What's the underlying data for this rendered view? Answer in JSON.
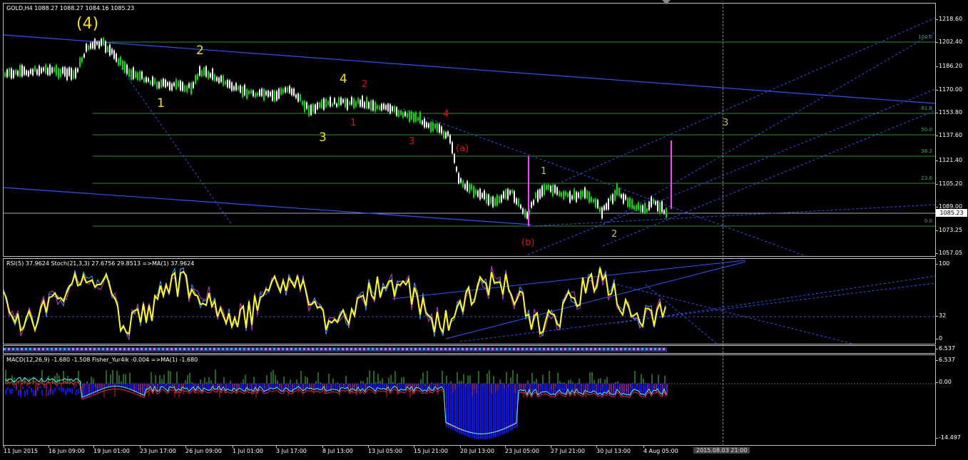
{
  "symbol_header": "GOLD,H4  1088.27 1088.27 1084.16 1085.23",
  "current_price": "1085.23",
  "price_scale": [
    "1218.60",
    "1202.40",
    "1186.20",
    "1170.00",
    "1153.80",
    "1137.60",
    "1121.40",
    "1105.20",
    "1089.00",
    "1073.25",
    "1057.05"
  ],
  "fibo_levels": [
    "100.0",
    "61.8",
    "50.0",
    "38.2",
    "23.6",
    "0.0"
  ],
  "wave_labels": {
    "w4_major": "(4)",
    "y1": "1",
    "y2": "2",
    "y3": "3",
    "y4": "4",
    "r1": "1",
    "r2": "2",
    "r3": "3",
    "r4": "4",
    "ra": "(a)",
    "rb": "(b)",
    "g1": "1",
    "g2": "2",
    "g3": "3"
  },
  "rsi_header": "RSI(5) 37.9624  Stoch(21,3,3) 27.6756 29.8513  =>MA(1) 37.9624",
  "rsi_scale": [
    "100",
    "32",
    "0"
  ],
  "mini_scale": "6.537",
  "macd_header": "MACD(12,26,9) -1.680 -1.508  Fisher_Yur4ik -0.004  =>MA(1) -1.680",
  "macd_scale": [
    "6.537",
    "0.00",
    "-14.497"
  ],
  "time_axis": [
    "11 Jun 2015",
    "16 Jun 09:00",
    "19 Jun 01:00",
    "23 Jun 17:00",
    "26 Jun 09:00",
    "1 Jul 01:00",
    "3 Jul 17:00",
    "8 Jul 13:00",
    "13 Jul 05:00",
    "15 Jul 21:00",
    "20 Jul 13:00",
    "23 Jul 05:00",
    "27 Jul 21:00",
    "30 Jul 13:00",
    "4 Aug 05:00"
  ],
  "cursor_date": "2015.08.03 21:00",
  "colors": {
    "bull": "#00e000",
    "bear": "#ffffff",
    "fib": "#2e8b2e",
    "channel": "#3050ff",
    "magenta": "#ff40ff",
    "rsi": "#ffff00",
    "macd_hist": "#1010ff"
  }
}
